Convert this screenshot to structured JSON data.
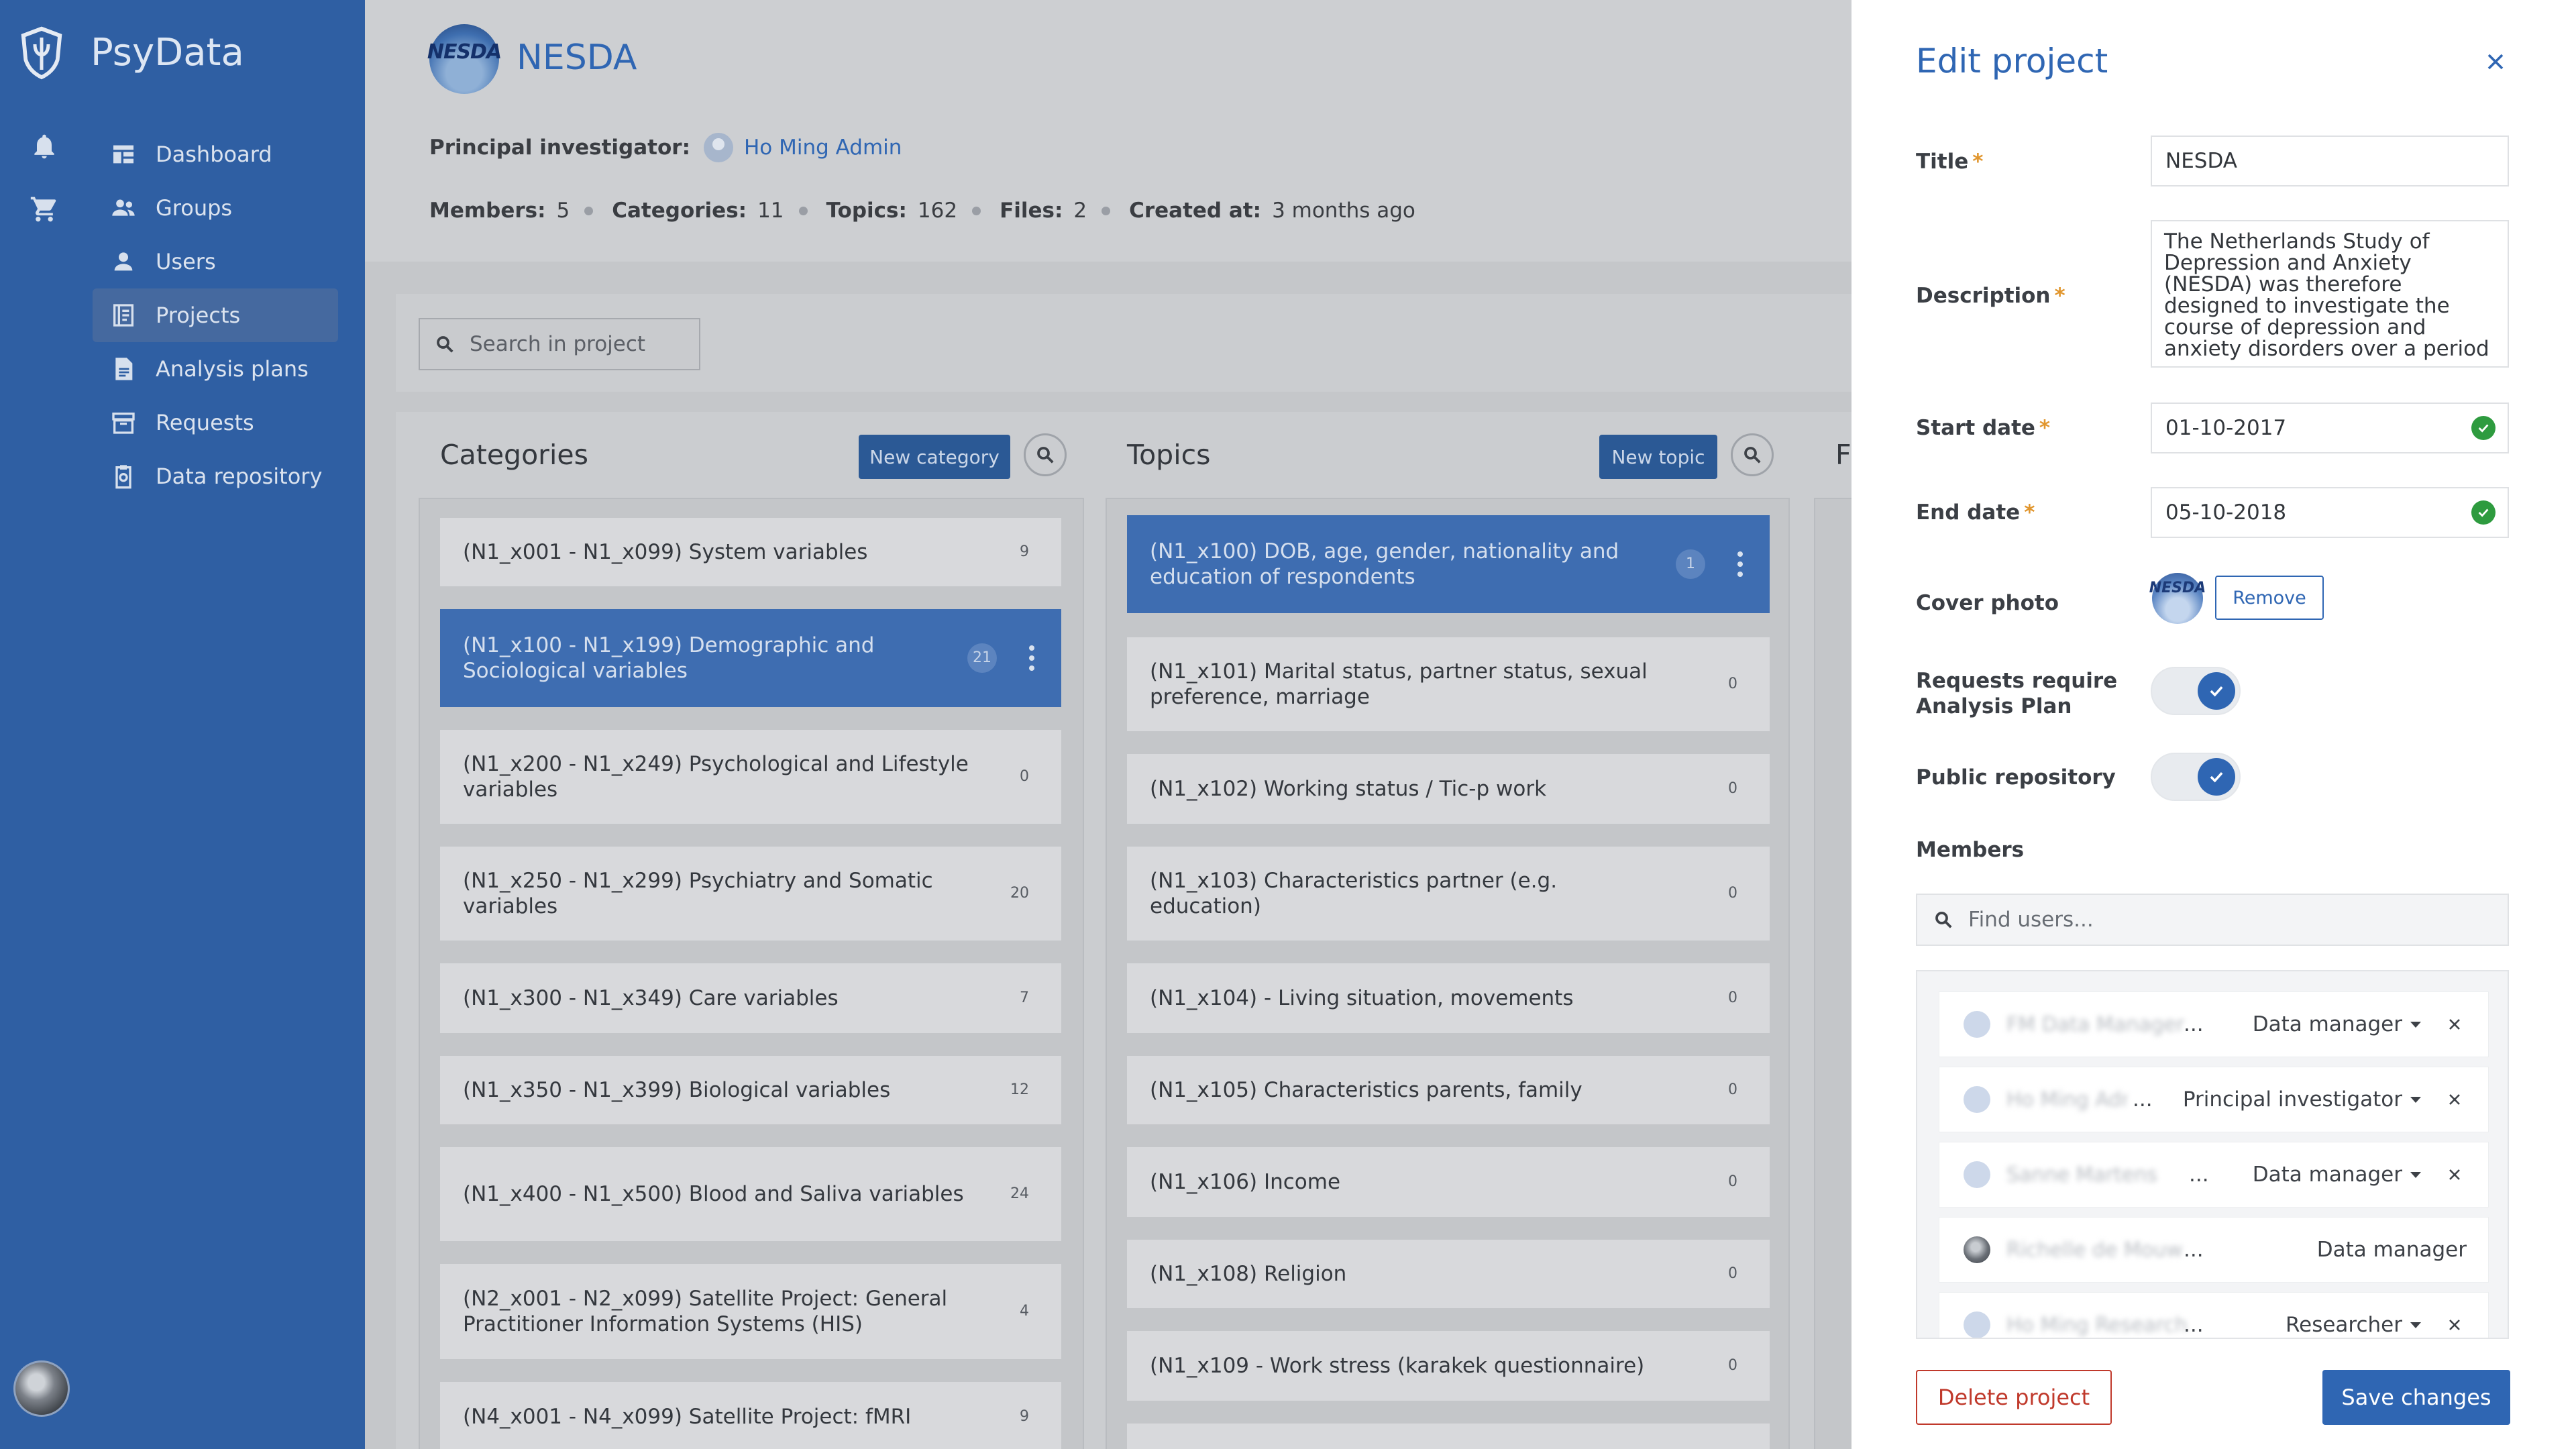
{
  "sidebar": {
    "brand": "PsyData",
    "items": [
      {
        "label": "Dashboard",
        "icon": "dashboard-icon"
      },
      {
        "label": "Groups",
        "icon": "groups-icon"
      },
      {
        "label": "Users",
        "icon": "user-icon"
      },
      {
        "label": "Projects",
        "icon": "projects-icon",
        "active": true
      },
      {
        "label": "Analysis plans",
        "icon": "document-icon"
      },
      {
        "label": "Requests",
        "icon": "archive-icon"
      },
      {
        "label": "Data repository",
        "icon": "clipboard-icon"
      }
    ]
  },
  "project": {
    "logo_text": "NESDA",
    "title": "NESDA",
    "pi_label": "Principal investigator:",
    "pi_name": "Ho Ming Admin",
    "stats": [
      {
        "label": "Members:",
        "value": "5"
      },
      {
        "label": "Categories:",
        "value": "11"
      },
      {
        "label": "Topics:",
        "value": "162"
      },
      {
        "label": "Files:",
        "value": "2"
      },
      {
        "label": "Created at:",
        "value": "3 months ago"
      }
    ],
    "search_placeholder": "Search in project"
  },
  "categories": {
    "title": "Categories",
    "new_label": "New category",
    "items": [
      {
        "text": "(N1_x001 - N1_x099) System variables",
        "count": "9"
      },
      {
        "text": "(N1_x100 - N1_x199) Demographic and Sociological variables",
        "count": "21",
        "active": true
      },
      {
        "text": "(N1_x200 - N1_x249) Psychological and Lifestyle variables",
        "count": "0"
      },
      {
        "text": "(N1_x250 - N1_x299) Psychiatry and Somatic variables",
        "count": "20"
      },
      {
        "text": "(N1_x300 - N1_x349) Care variables",
        "count": "7"
      },
      {
        "text": "(N1_x350 - N1_x399) Biological variables",
        "count": "12"
      },
      {
        "text": "(N1_x400 - N1_x500) Blood and Saliva variables",
        "count": "24"
      },
      {
        "text": "(N2_x001 - N2_x099) Satellite Project: General Practitioner Information Systems (HIS)",
        "count": "4"
      },
      {
        "text": "(N4_x001 - N4_x099) Satellite Project: fMRI",
        "count": "9"
      }
    ]
  },
  "topics": {
    "title": "Topics",
    "new_label": "New topic",
    "items": [
      {
        "text": "(N1_x100) DOB, age, gender, nationality and education of respondents",
        "count": "1",
        "active": true
      },
      {
        "text": "(N1_x101) Marital status, partner status, sexual preference, marriage",
        "count": "0"
      },
      {
        "text": "(N1_x102) Working status / Tic-p work",
        "count": "0"
      },
      {
        "text": "(N1_x103) Characteristics partner (e.g. education)",
        "count": "0"
      },
      {
        "text": "(N1_x104) - Living situation, movements",
        "count": "0"
      },
      {
        "text": "(N1_x105) Characteristics parents, family",
        "count": "0"
      },
      {
        "text": "(N1_x106) Income",
        "count": "0"
      },
      {
        "text": "(N1_x108) Religion",
        "count": "0"
      },
      {
        "text": "(N1_x109 - Work stress (karakek questionnaire)",
        "count": "0"
      }
    ]
  },
  "third_col_initial": "F",
  "edit": {
    "title": "Edit project",
    "title_label": "Title",
    "title_value": "NESDA",
    "description_label": "Description",
    "description_value": "The Netherlands Study of Depression and Anxiety (NESDA) was therefore designed to investigate the course of depression and anxiety disorders over a period",
    "start_label": "Start date",
    "start_value": "01-10-2017",
    "end_label": "End date",
    "end_value": "05-10-2018",
    "cover_label": "Cover photo",
    "cover_logo_text": "NESDA",
    "remove_label": "Remove",
    "req_plan_label": "Requests require Analysis Plan",
    "req_plan_on": true,
    "public_label": "Public repository",
    "public_on": true,
    "members_label": "Members",
    "find_placeholder": "Find users...",
    "members": [
      {
        "name": "FM Data Manager",
        "role": "Data manager",
        "editable": true
      },
      {
        "name": "Ho Ming Admin",
        "role": "Principal investigator",
        "editable": true
      },
      {
        "name": "Sanne Martens",
        "role": "Data manager",
        "editable": true
      },
      {
        "name": "Richelle de Mouw",
        "role": "Data manager",
        "editable": false
      },
      {
        "name": "Ho Ming Research",
        "role": "Researcher",
        "editable": true
      }
    ],
    "ellipsis": "...",
    "delete_label": "Delete project",
    "save_label": "Save changes"
  },
  "colors": {
    "sidebar": "#2f5fa3",
    "accent": "#2f66b3",
    "danger": "#c0392b",
    "success": "#2e9b3f",
    "required": "#e1962e"
  }
}
